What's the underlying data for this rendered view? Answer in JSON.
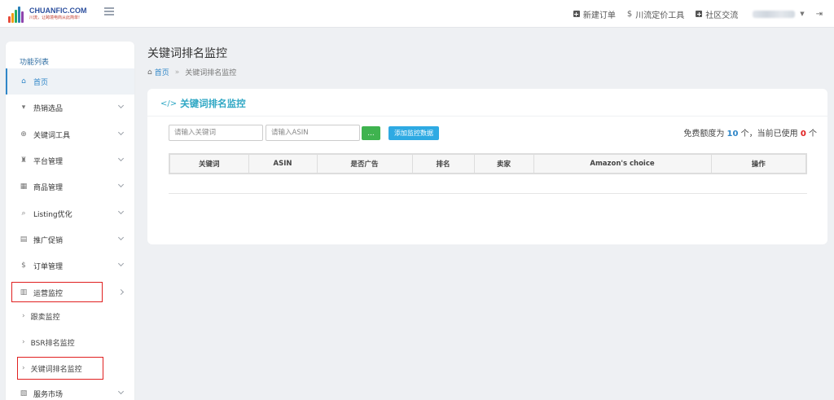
{
  "header": {
    "logo_name": "CHUANFIC.COM",
    "logo_slogan": "川流，让跨境电商从此简单!",
    "nav": [
      {
        "icon": "plus-square-icon",
        "label": "新建订单"
      },
      {
        "icon": "dollar-icon",
        "label": "川流定价工具"
      },
      {
        "icon": "plus-square-icon",
        "label": "社区交流"
      }
    ]
  },
  "sidebar": {
    "title": "功能列表",
    "items": [
      {
        "label": "首页",
        "icon": "home-icon"
      },
      {
        "label": "热销选品",
        "icon": "cart-icon"
      },
      {
        "label": "关键词工具",
        "icon": "search-plus-icon"
      },
      {
        "label": "平台管理",
        "icon": "binoculars-icon"
      },
      {
        "label": "商品管理",
        "icon": "grid-icon"
      },
      {
        "label": "Listing优化",
        "icon": "search-icon"
      },
      {
        "label": "推广促销",
        "icon": "briefcase-icon"
      },
      {
        "label": "订单管理",
        "icon": "dollar-icon"
      },
      {
        "label": "运营监控",
        "icon": "bar-chart-icon"
      }
    ],
    "sub_items": [
      {
        "label": "跟卖监控"
      },
      {
        "label": "BSR排名监控"
      },
      {
        "label": "关键词排名监控"
      }
    ],
    "last_item": {
      "label": "服务市场",
      "icon": "map-icon"
    }
  },
  "main": {
    "page_title": "关键词排名监控",
    "breadcrumb": {
      "home": "首页",
      "sep": "»",
      "current": "关键词排名监控"
    },
    "panel_title": "关键词排名监控",
    "keyword_placeholder": "请输入关键词",
    "asin_placeholder": "请输入ASIN",
    "go_label": "...",
    "add_label": "添加监控数据",
    "quota": {
      "prefix": "免费额度为",
      "limit": "10",
      "middle": "个，当前已使用",
      "used": "0",
      "suffix": "个"
    },
    "table_headers": [
      "关键词",
      "ASIN",
      "是否广告",
      "排名",
      "卖家",
      "Amazon's choice",
      "操作"
    ]
  },
  "colors": {
    "accent": "#2f86c8",
    "title_teal": "#2fa7c4",
    "green": "#3fb34f",
    "blue_btn": "#2eaae3",
    "highlight_red": "#e02020"
  }
}
